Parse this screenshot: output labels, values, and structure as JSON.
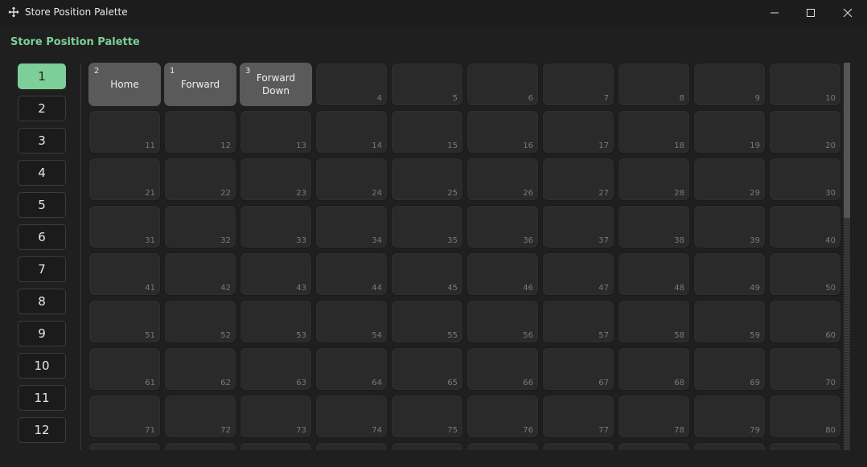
{
  "window": {
    "title": "Store Position Palette",
    "app_icon": "move-icon"
  },
  "header": {
    "title": "Store Position Palette"
  },
  "sidebar": {
    "items": [
      {
        "label": "1",
        "active": true
      },
      {
        "label": "2"
      },
      {
        "label": "3"
      },
      {
        "label": "4"
      },
      {
        "label": "5"
      },
      {
        "label": "6"
      },
      {
        "label": "7"
      },
      {
        "label": "8"
      },
      {
        "label": "9"
      },
      {
        "label": "10"
      },
      {
        "label": "11"
      },
      {
        "label": "12"
      }
    ]
  },
  "grid": {
    "columns": 10,
    "cells_total": 90,
    "filled": [
      {
        "slot": 1,
        "index": "2",
        "label": "Home"
      },
      {
        "slot": 2,
        "index": "1",
        "label": "Forward"
      },
      {
        "slot": 3,
        "index": "3",
        "label": "Forward Down"
      }
    ]
  },
  "scrollbar": {
    "thumb_fraction": 0.4
  },
  "colors": {
    "accent": "#7ccf98",
    "background": "#1f1f1f",
    "cell": "#2a2a2a",
    "cell_filled": "#5a5a5a"
  }
}
